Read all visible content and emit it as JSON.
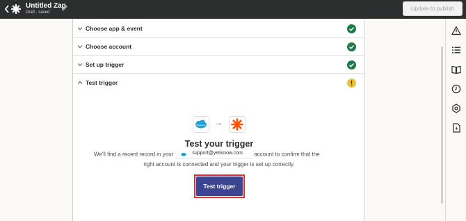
{
  "topbar": {
    "back_icon": "chevron-left-icon",
    "logo_icon": "zapier-asterisk-icon",
    "title": "Untitled Zap",
    "edit_icon": "pencil-icon",
    "status": "Draft · saved",
    "publish_label": "Update to publish"
  },
  "steps": [
    {
      "label": "Choose app & event",
      "status": "complete"
    },
    {
      "label": "Choose account",
      "status": "complete"
    },
    {
      "label": "Set up trigger",
      "status": "complete"
    },
    {
      "label": "Test trigger",
      "status": "warning"
    }
  ],
  "trigger_panel": {
    "title": "Test your trigger",
    "description_before": "We'll find a recent record in your",
    "account_email": "support@yetisnow.com",
    "description_after": "account to confirm that the",
    "description_line2": "right account is connected and your trigger is set up correctly.",
    "button_label": "Test trigger"
  },
  "colors": {
    "topbar": "#2d2e2e",
    "complete": "#1f7a4a",
    "warning": "#e9c238",
    "button": "#3d4592",
    "highlight": "#e0312e",
    "salesforce": "#1ea0d9",
    "zapier": "#ff4f00"
  },
  "rail_icons": [
    "alert-triangle-icon",
    "list-icon",
    "book-icon",
    "clock-icon",
    "settings-gear-icon",
    "file-bolt-icon"
  ]
}
